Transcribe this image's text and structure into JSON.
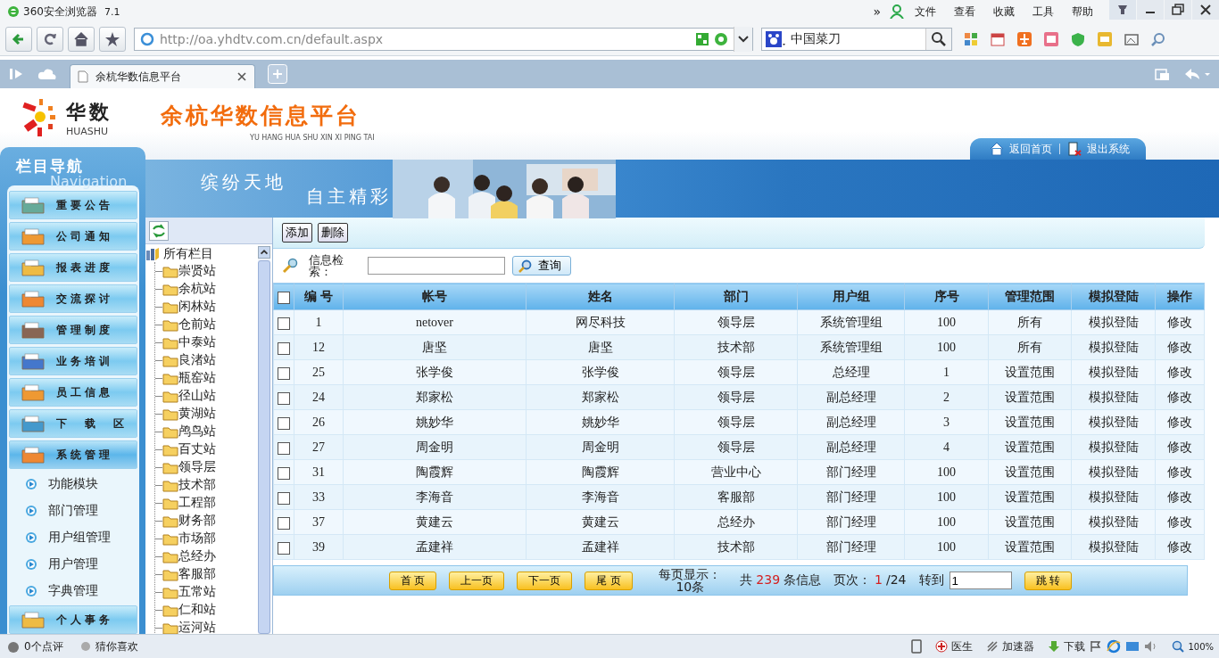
{
  "browser": {
    "title": "360安全浏览器",
    "version": "7.1",
    "more": "»",
    "menu": [
      "文件",
      "查看",
      "收藏",
      "工具",
      "帮助"
    ],
    "address": "http://oa.yhdtv.com.cn/default.aspx",
    "search_value": "中国菜刀",
    "tabs": [
      {
        "title": "余杭华数信息平台",
        "selected": true
      }
    ]
  },
  "header": {
    "logo_cn": "华数",
    "logo_en": "HUASHU",
    "title": "余杭华数信息平台",
    "subtitle": "YU HANG HUA SHU XIN XI PING TAI",
    "links": [
      "返回首页",
      "退出系统"
    ],
    "banner": [
      "缤纷天地",
      "自主精彩"
    ]
  },
  "nav": {
    "title": "栏目导航",
    "watermark": "Navigation",
    "sections": [
      {
        "label": "重要公告",
        "expanded": false
      },
      {
        "label": "公司通知",
        "expanded": false
      },
      {
        "label": "报表进度",
        "expanded": false
      },
      {
        "label": "交流探讨",
        "expanded": false
      },
      {
        "label": "管理制度",
        "expanded": false
      },
      {
        "label": "业务培训",
        "expanded": false
      },
      {
        "label": "员工信息",
        "expanded": false
      },
      {
        "label": "下　载　区",
        "expanded": false
      },
      {
        "label": "系统管理",
        "expanded": true,
        "children": [
          "功能模块",
          "部门管理",
          "用户组管理",
          "用户管理",
          "字典管理"
        ]
      },
      {
        "label": "个人事务",
        "expanded": false
      }
    ]
  },
  "tree": {
    "root": "所有栏目",
    "children": [
      "崇贤站",
      "余杭站",
      "闲林站",
      "仓前站",
      "中泰站",
      "良渚站",
      "瓶窑站",
      "径山站",
      "黄湖站",
      "鸬鸟站",
      "百丈站",
      "领导层",
      "技术部",
      "工程部",
      "财务部",
      "市场部",
      "总经办",
      "客服部",
      "五常站",
      "仁和站",
      "运河站"
    ]
  },
  "toolbar": {
    "buttons": [
      "添加",
      "删除"
    ],
    "search_label": "信息检索：",
    "search_button": "查询"
  },
  "table": {
    "header_checked": false,
    "columns": [
      "编 号",
      "帐号",
      "姓名",
      "部门",
      "用户组",
      "序号",
      "管理范围",
      "模拟登陆",
      "操作"
    ],
    "rows": [
      {
        "checked": false,
        "cells": [
          "1",
          "netover",
          "网尽科技",
          "领导层",
          "系统管理组",
          "100",
          "所有",
          "模拟登陆",
          "修改"
        ]
      },
      {
        "checked": false,
        "cells": [
          "12",
          "唐坚",
          "唐坚",
          "技术部",
          "系统管理组",
          "100",
          "所有",
          "模拟登陆",
          "修改"
        ]
      },
      {
        "checked": false,
        "cells": [
          "25",
          "张学俊",
          "张学俊",
          "领导层",
          "总经理",
          "1",
          "设置范围",
          "模拟登陆",
          "修改"
        ]
      },
      {
        "checked": false,
        "cells": [
          "24",
          "郑家松",
          "郑家松",
          "领导层",
          "副总经理",
          "2",
          "设置范围",
          "模拟登陆",
          "修改"
        ]
      },
      {
        "checked": false,
        "cells": [
          "26",
          "姚妙华",
          "姚妙华",
          "领导层",
          "副总经理",
          "3",
          "设置范围",
          "模拟登陆",
          "修改"
        ]
      },
      {
        "checked": false,
        "cells": [
          "27",
          "周金明",
          "周金明",
          "领导层",
          "副总经理",
          "4",
          "设置范围",
          "模拟登陆",
          "修改"
        ]
      },
      {
        "checked": false,
        "cells": [
          "31",
          "陶霞辉",
          "陶霞辉",
          "营业中心",
          "部门经理",
          "100",
          "设置范围",
          "模拟登陆",
          "修改"
        ]
      },
      {
        "checked": false,
        "cells": [
          "33",
          "李海音",
          "李海音",
          "客服部",
          "部门经理",
          "100",
          "设置范围",
          "模拟登陆",
          "修改"
        ]
      },
      {
        "checked": false,
        "cells": [
          "37",
          "黄建云",
          "黄建云",
          "总经办",
          "部门经理",
          "100",
          "设置范围",
          "模拟登陆",
          "修改"
        ]
      },
      {
        "checked": false,
        "cells": [
          "39",
          "孟建祥",
          "孟建祥",
          "技术部",
          "部门经理",
          "100",
          "设置范围",
          "模拟登陆",
          "修改"
        ]
      }
    ]
  },
  "pager": {
    "buttons": [
      "首 页",
      "上一页",
      "下一页",
      "尾 页"
    ],
    "per_page": "每页显示：10条",
    "total_prefix": "共",
    "total": "239",
    "total_suffix": "条信息",
    "page_label": "页次：",
    "page_current": "1",
    "page_count": "/24",
    "goto_label": "转到",
    "goto_value": "1",
    "goto_button": "跳 转"
  },
  "status_bar": {
    "left": [
      "0个点评",
      "猜你喜欢"
    ],
    "right": [
      "医生",
      "加速器",
      "下载"
    ],
    "zoom": "100%"
  }
}
